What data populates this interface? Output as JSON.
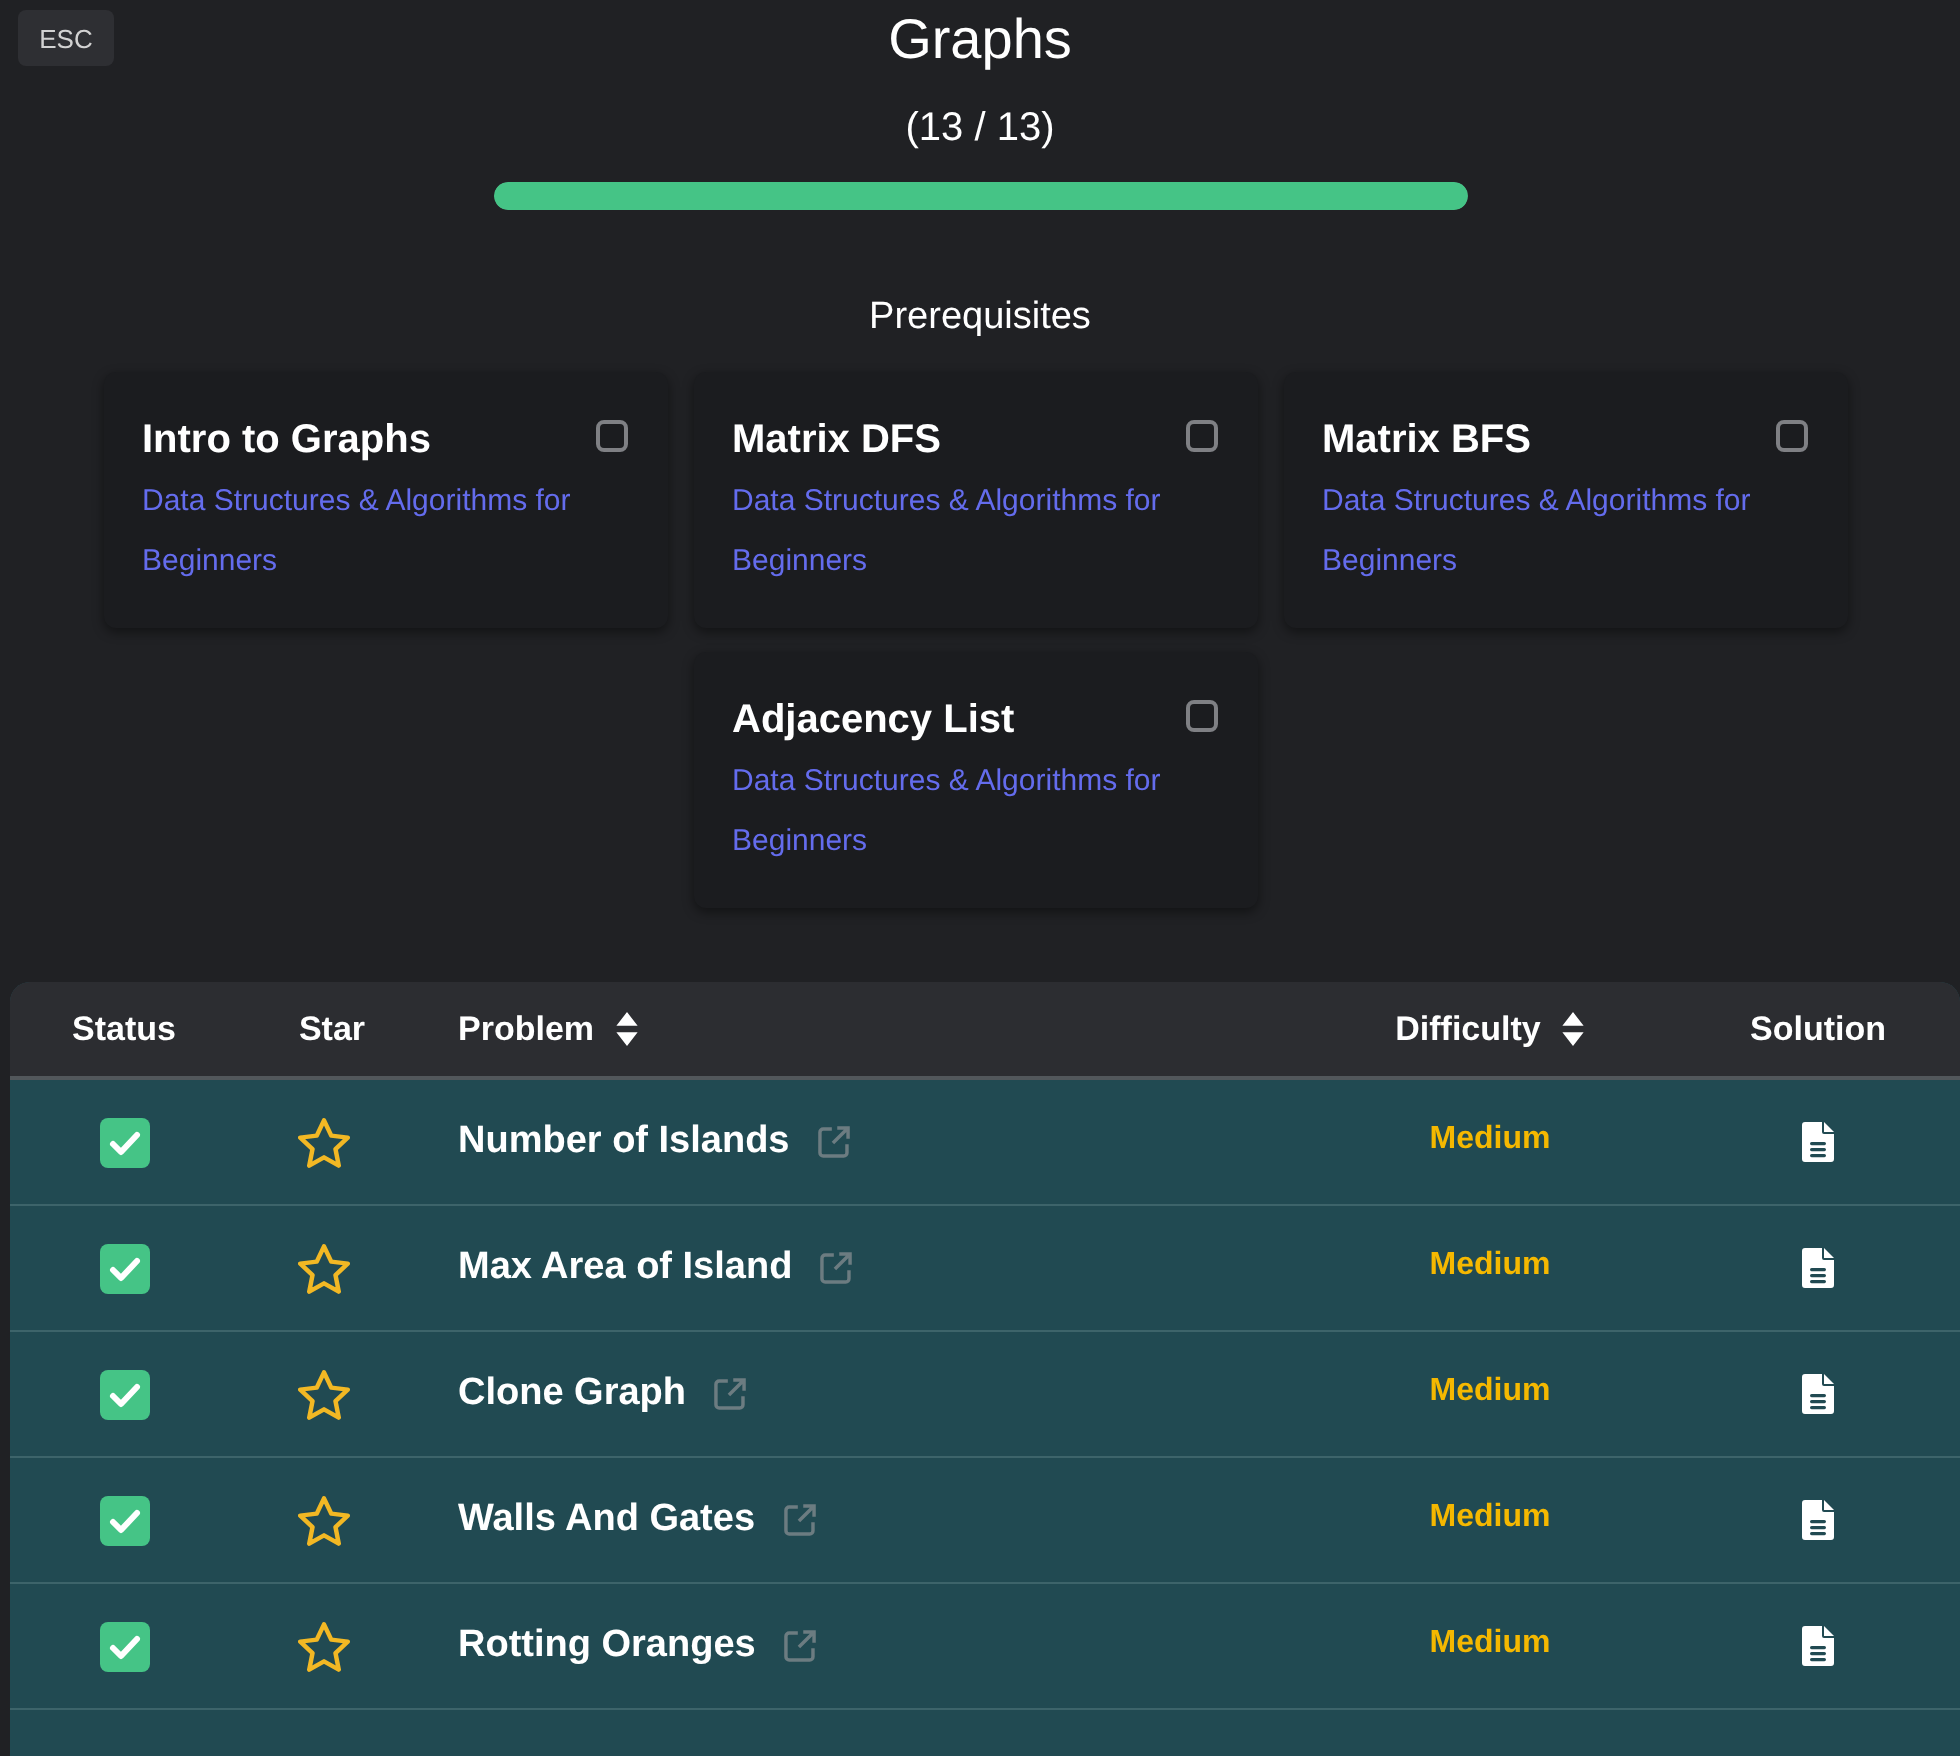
{
  "header": {
    "close_button": "ESC",
    "title": "Graphs",
    "progress_text": "(13 / 13)",
    "progress": {
      "level": 1
    }
  },
  "prerequisites": {
    "heading": "Prerequisites",
    "cards": [
      {
        "title": "Intro to Graphs",
        "course": "Data Structures & Algorithms for Beginners",
        "checked": false
      },
      {
        "title": "Matrix DFS",
        "course": "Data Structures & Algorithms for Beginners",
        "checked": false
      },
      {
        "title": "Matrix BFS",
        "course": "Data Structures & Algorithms for Beginners",
        "checked": false
      },
      {
        "title": "Adjacency List",
        "course": "Data Structures & Algorithms for Beginners",
        "checked": false
      }
    ]
  },
  "table": {
    "columns": [
      {
        "label": "Status",
        "sortable": false
      },
      {
        "label": "Star",
        "sortable": false
      },
      {
        "label": "Problem",
        "sortable": true
      },
      {
        "label": "Difficulty",
        "sortable": true
      },
      {
        "label": "Solution",
        "sortable": false
      }
    ],
    "rows": [
      {
        "completed": true,
        "starred": false,
        "problem": "Number of Islands",
        "difficulty": {
          "label": "Medium",
          "color": "#f5b800"
        },
        "has_solution": true
      },
      {
        "completed": true,
        "starred": false,
        "problem": "Max Area of Island",
        "difficulty": {
          "label": "Medium",
          "color": "#f5b800"
        },
        "has_solution": true
      },
      {
        "completed": true,
        "starred": false,
        "problem": "Clone Graph",
        "difficulty": {
          "label": "Medium",
          "color": "#f5b800"
        },
        "has_solution": true
      },
      {
        "completed": true,
        "starred": false,
        "problem": "Walls And Gates",
        "difficulty": {
          "label": "Medium",
          "color": "#f5b800"
        },
        "has_solution": true
      },
      {
        "completed": true,
        "starred": false,
        "problem": "Rotting Oranges",
        "difficulty": {
          "label": "Medium",
          "color": "#f5b800"
        },
        "has_solution": true
      }
    ]
  }
}
